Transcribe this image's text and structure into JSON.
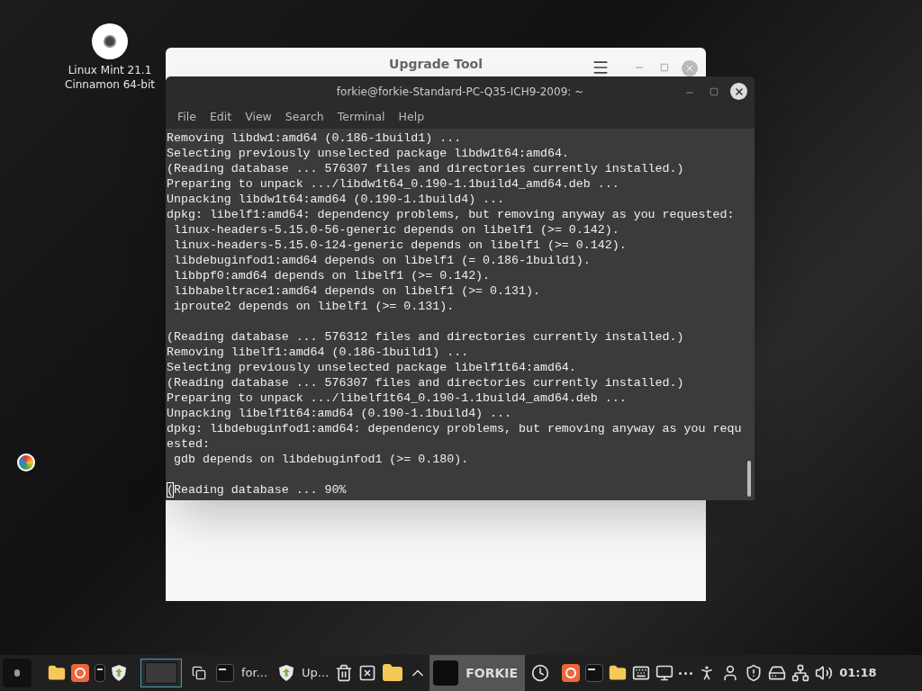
{
  "desktop_icons": [
    {
      "lines": [
        "Linux Mint 21.1",
        "Cinnamon 64-bit"
      ]
    }
  ],
  "upgrade_window": {
    "title": "Upgrade Tool"
  },
  "terminal": {
    "title": "forkie@forkie-Standard-PC-Q35-ICH9-2009: ~",
    "menu": [
      "File",
      "Edit",
      "View",
      "Search",
      "Terminal",
      "Help"
    ],
    "cursor_visible": true,
    "blocks": [
      [
        "Removing libdw1:amd64 (0.186-1build1) ...",
        "Selecting previously unselected package libdw1t64:amd64.",
        "(Reading database ... 576307 files and directories currently installed.)",
        "Preparing to unpack .../libdw1t64_0.190-1.1build4_amd64.deb ...",
        "Unpacking libdw1t64:amd64 (0.190-1.1build4) ...",
        "dpkg: libelf1:amd64: dependency problems, but removing anyway as you requested:",
        " linux-headers-5.15.0-56-generic depends on libelf1 (>= 0.142).",
        " linux-headers-5.15.0-124-generic depends on libelf1 (>= 0.142).",
        " libdebuginfod1:amd64 depends on libelf1 (= 0.186-1build1).",
        " libbpf0:amd64 depends on libelf1 (>= 0.142).",
        " libbabeltrace1:amd64 depends on libelf1 (>= 0.131).",
        " iproute2 depends on libelf1 (>= 0.131)."
      ],
      [
        "(Reading database ... 576312 files and directories currently installed.)",
        "Removing libelf1:amd64 (0.186-1build1) ...",
        "Selecting previously unselected package libelf1t64:amd64.",
        "(Reading database ... 576307 files and directories currently installed.)",
        "Preparing to unpack .../libelf1t64_0.190-1.1build4_amd64.deb ...",
        "Unpacking libelf1t64:amd64 (0.190-1.1build4) ...",
        "dpkg: libdebuginfod1:amd64: dependency problems, but removing anyway as you requ",
        "ested:",
        " gdb depends on libdebuginfod1 (>= 0.180)."
      ],
      [
        "(Reading database ... 90%"
      ]
    ]
  },
  "taskbar": {
    "window_buttons": [
      {
        "kind": "terminal",
        "label": "for..."
      },
      {
        "kind": "update",
        "label": "Up..."
      }
    ],
    "workspace": {
      "label": "FORKIE",
      "selected": true
    },
    "clock": "01:18"
  }
}
